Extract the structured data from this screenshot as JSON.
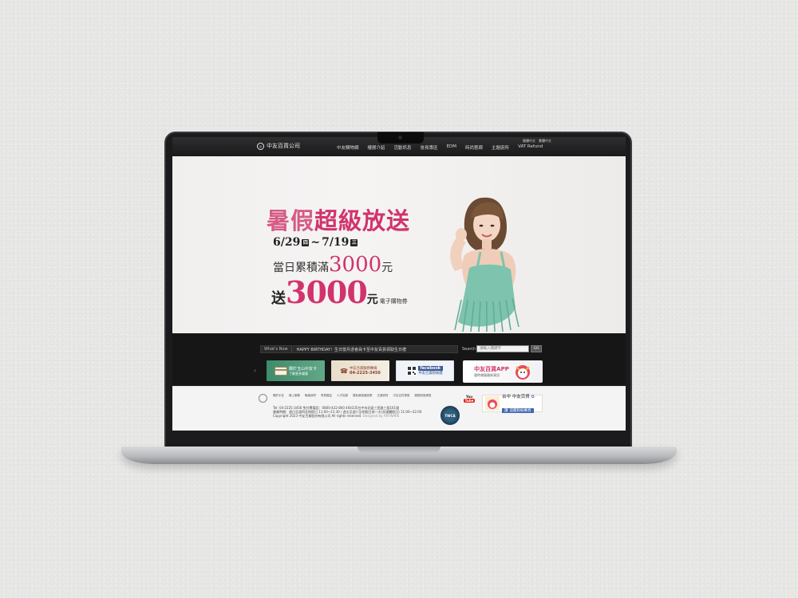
{
  "nav": {
    "logo_text": "中友百貨公司",
    "items": [
      "中友購物網",
      "樓層介紹",
      "活動訊息",
      "會員專區",
      "EDM",
      "時尚藝廊",
      "主題廚所",
      "VAT Refund"
    ],
    "lang": [
      "簡體中文",
      "繁體中文"
    ]
  },
  "banner": {
    "headline_pale": "暑假",
    "headline_strong": "超級放送",
    "date_start": "6/29",
    "day_start": "四",
    "date_sep": "~",
    "date_end": "7/19",
    "day_end": "三",
    "line1_text": "當日累積滿",
    "line1_amount": "3000",
    "line1_unit": "元",
    "line2_send": "送",
    "line2_amount": "3000",
    "line2_unit": "元",
    "line2_voucher": "電子購物券"
  },
  "ticker": {
    "label": "What's Now",
    "text": "HAPPY BIRTHDAY！生日當月憑會員卡至中友百貨領取生日禮",
    "search_label": "Search",
    "search_placeholder": "請輸入關鍵字",
    "search_button": "GO"
  },
  "promos": {
    "prev": "‹",
    "p1": "關於玉山中友卡",
    "p1_sub": "了解更多優惠",
    "p2": "中友百貨服務專線",
    "p2_phone": "04-2225-3456",
    "p3": "facebook",
    "p3_sub": "中友百貨粉絲團",
    "p4": "中友百貨APP",
    "p4_sub": "隨時掌握最新資訊"
  },
  "footer": {
    "links": [
      "關於中友",
      "線上服務",
      "聯絡我們",
      "會員權益",
      "人才招募",
      "隱私權保護政策",
      "交通資訊",
      "中友百貨專區",
      "服務設施專區"
    ],
    "tel": "Tel: 04-2225-3456  免付費電話：0800-422-800  404335台中市北區三民路三段161號",
    "hours": "營業時間：週日至週四及例假日 11:00~21:30 / 週五至週六及例假日前一天(含連續假日) 11:00~22:00",
    "copyright": "Copyright 2023 中友百貨股份有限公司 All rights reserved.",
    "designed": "Designed by ARTWARE",
    "twca": "TWCA",
    "youtube_top": "You",
    "youtube_bottom": "Tube",
    "fb_title": "台中 中友百貨",
    "fb_like": "讚",
    "fb_sub": "追蹤粉絲專頁"
  },
  "colors": {
    "accent": "#d1336d",
    "nav_bg": "#1a1a1b",
    "strip_bg": "#161616"
  }
}
